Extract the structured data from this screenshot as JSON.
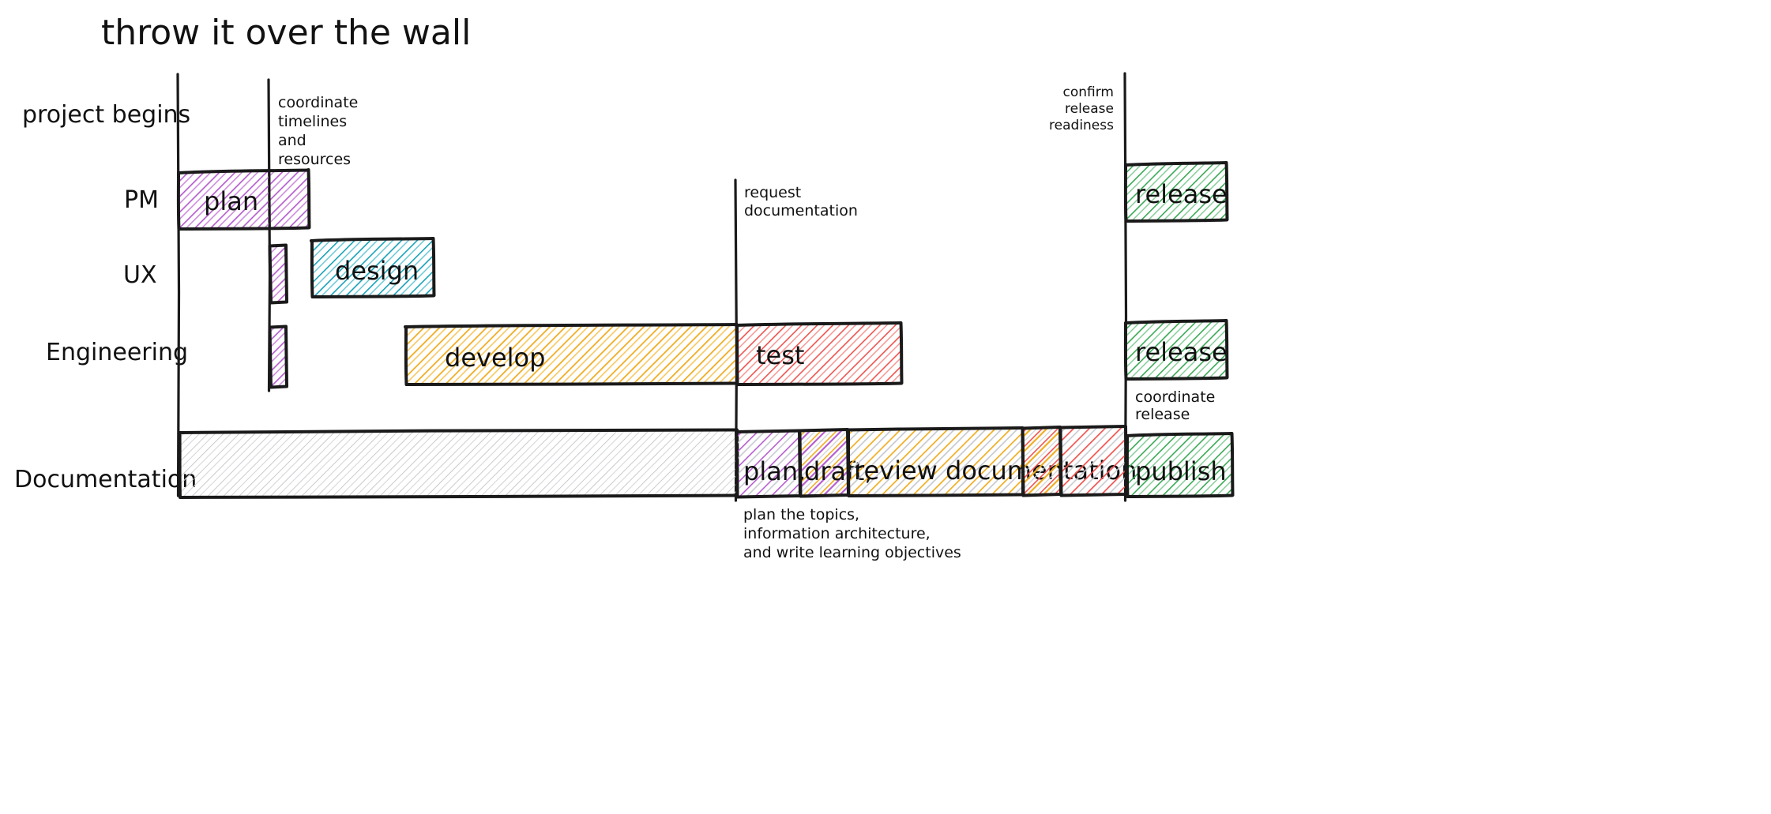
{
  "title": "throw it over the wall",
  "chart_data": {
    "type": "bar",
    "title": "throw it over the wall",
    "subtitle": "",
    "xlabel": "",
    "ylabel": "",
    "grid": false,
    "legend_position": "none",
    "orientation": "horizontal-gantt",
    "xlim": [
      0,
      100
    ],
    "axis_lines": [
      {
        "name": "project-begins",
        "x_value": 1.5,
        "label": "project begins"
      },
      {
        "name": "coordinate-timelines",
        "x_value": 7.0,
        "label": "coordinate timelines and resources"
      },
      {
        "name": "request-documentation",
        "x_value": 37.5,
        "label": "request documentation"
      },
      {
        "name": "confirm-release-readiness",
        "x_value": 62.0,
        "label": "confirm release readiness"
      }
    ],
    "categories": [
      "PM",
      "UX",
      "Engineering",
      "Documentation"
    ],
    "series": [
      {
        "name": "PM",
        "bars": [
          {
            "label": "plan",
            "start": 1.5,
            "end": 10.5,
            "color": "#b65fcf",
            "row": "PM"
          },
          {
            "label": "release",
            "start": 62.0,
            "end": 69.5,
            "color": "#3aa955",
            "row": "PM"
          }
        ]
      },
      {
        "name": "UX",
        "bars": [
          {
            "label": "",
            "start": 7.0,
            "end": 8.0,
            "color": "#b65fcf",
            "row": "UX"
          },
          {
            "label": "design",
            "start": 11.5,
            "end": 19.5,
            "color": "#17a2b8",
            "row": "UX"
          }
        ]
      },
      {
        "name": "Engineering",
        "bars": [
          {
            "label": "",
            "start": 7.0,
            "end": 8.0,
            "color": "#b65fcf",
            "row": "Engineering"
          },
          {
            "label": "develop",
            "start": 20.5,
            "end": 37.5,
            "color": "#f0ad22",
            "row": "Engineering"
          },
          {
            "label": "test",
            "start": 37.5,
            "end": 47.0,
            "color": "#ef5350",
            "row": "Engineering"
          },
          {
            "label": "release",
            "start": 62.0,
            "end": 69.5,
            "color": "#3aa955",
            "row": "Engineering"
          }
        ]
      },
      {
        "name": "Documentation",
        "bars": [
          {
            "label": "",
            "start": 1.5,
            "end": 37.5,
            "color": "#cfd2d6",
            "row": "Documentation"
          },
          {
            "label": "plan,",
            "start": 37.5,
            "end": 41.0,
            "color": "#b65fcf",
            "row": "Documentation"
          },
          {
            "label": "draft,",
            "start": 41.0,
            "end": 44.2,
            "color": "#f0ad22",
            "row": "Documentation"
          },
          {
            "label": "review documentation",
            "start": 44.2,
            "end": 54.0,
            "color": "#f0ad22",
            "row": "Documentation"
          },
          {
            "label": "",
            "start": 54.0,
            "end": 57.0,
            "color": "#ef5350",
            "row": "Documentation"
          },
          {
            "label": "",
            "start": 57.0,
            "end": 62.0,
            "color": "#ef5350",
            "row": "Documentation"
          },
          {
            "label": "publish",
            "start": 62.0,
            "end": 69.5,
            "color": "#3aa955",
            "row": "Documentation"
          }
        ]
      }
    ]
  },
  "row_labels": [
    {
      "id": "project-begins",
      "text": "project begins"
    },
    {
      "id": "pm",
      "text": "PM"
    },
    {
      "id": "ux",
      "text": "UX"
    },
    {
      "id": "engineering",
      "text": "Engineering"
    },
    {
      "id": "documentation",
      "text": "Documentation"
    }
  ],
  "bar_labels": {
    "plan": "plan",
    "design": "design",
    "develop": "develop",
    "test": "test",
    "release_pm": "release",
    "release_eng": "release",
    "doc_plan": "plan,",
    "doc_draft": "draft,",
    "doc_review": "review documentation",
    "publish": "publish"
  },
  "annotations": {
    "coordinate": [
      "coordinate",
      "timelines",
      "and",
      "resources"
    ],
    "request_documentation": [
      "request",
      "documentation"
    ],
    "confirm_release": [
      "confirm",
      "release",
      "readiness"
    ],
    "coordinate_release": [
      "coordinate",
      "release"
    ],
    "doc_detail": [
      "plan the topics,",
      "information architecture,",
      "and write learning objectives"
    ]
  },
  "colors": {
    "purple": "#b65fcf",
    "teal": "#17a2b8",
    "yellow": "#f0ad22",
    "red": "#ef5350",
    "green": "#3aa955",
    "gray": "#cfd2d6",
    "ink": "#1a1a1a",
    "background": "#ffffff"
  }
}
